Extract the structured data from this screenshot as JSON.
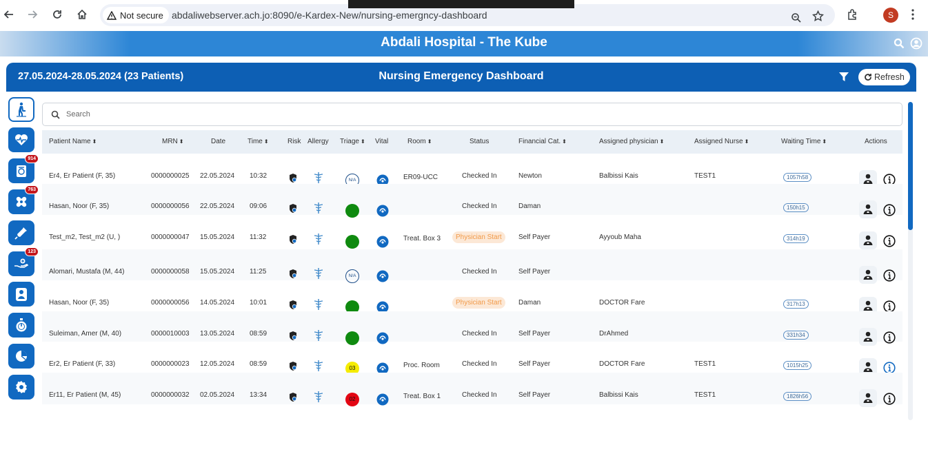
{
  "browser": {
    "security_label": "Not secure",
    "url": "abdaliwebserver.ach.jo:8090/e-Kardex-New/nursing-emergncy-dashboard",
    "profile_initial": "S"
  },
  "banner": {
    "title": "Abdali Hospital - The Kube"
  },
  "dashboard": {
    "date_range": "27.05.2024-28.05.2024 (23 Patients)",
    "title": "Nursing Emergency Dashboard",
    "refresh_label": "Refresh"
  },
  "sidebar": {
    "items": [
      {
        "icon": "patient-walking-icon",
        "badge": ""
      },
      {
        "icon": "heart-monitor-icon",
        "badge": ""
      },
      {
        "icon": "lab-report-icon",
        "badge": "914"
      },
      {
        "icon": "bandage-icon",
        "badge": "763"
      },
      {
        "icon": "syringe-icon",
        "badge": ""
      },
      {
        "icon": "hand-care-icon",
        "badge": "123"
      },
      {
        "icon": "nurse-icon",
        "badge": ""
      },
      {
        "icon": "stopwatch-icon",
        "badge": ""
      },
      {
        "icon": "pie-chart-icon",
        "badge": ""
      },
      {
        "icon": "settings-icon",
        "badge": ""
      }
    ]
  },
  "search": {
    "placeholder": "Search"
  },
  "table": {
    "headers": {
      "patient_name": "Patient Name",
      "mrn": "MRN",
      "date": "Date",
      "time": "Time",
      "risk": "Risk",
      "allergy": "Allergy",
      "triage": "Triage",
      "vital": "Vital",
      "room": "Room",
      "status": "Status",
      "financial": "Financial Cat.",
      "physician": "Assigned physician",
      "nurse": "Assigned Nurse",
      "waiting": "Waiting Time",
      "actions": "Actions"
    },
    "rows": [
      {
        "name": "Er4, Er Patient (F, 35)",
        "mrn": "0000000025",
        "date": "22.05.2024",
        "time": "10:32",
        "triage": "N/A",
        "triage_color": "none",
        "room": "ER09-UCC",
        "status": "Checked In",
        "status_pill": false,
        "financial": "Newton",
        "physician": "Balbissi Kais",
        "nurse": "TEST1",
        "waiting": "1057h58"
      },
      {
        "name": "Hasan, Noor (F, 35)",
        "mrn": "0000000056",
        "date": "22.05.2024",
        "time": "09:06",
        "triage": "04",
        "triage_color": "#0f8a0f",
        "room": "",
        "status": "Checked In",
        "status_pill": false,
        "financial": "Daman",
        "physician": "",
        "nurse": "",
        "waiting": "150h15"
      },
      {
        "name": "Test_m2, Test_m2 (U, )",
        "mrn": "0000000047",
        "date": "15.05.2024",
        "time": "11:32",
        "triage": "04",
        "triage_color": "#0f8a0f",
        "room": "Treat. Box 3",
        "status": "Physician Start",
        "status_pill": true,
        "financial": "Self Payer",
        "physician": "Ayyoub Maha",
        "nurse": "",
        "waiting": "314h19"
      },
      {
        "name": "Alomari, Mustafa (M, 44)",
        "mrn": "0000000058",
        "date": "15.05.2024",
        "time": "11:25",
        "triage": "N/A",
        "triage_color": "none",
        "room": "",
        "status": "Checked In",
        "status_pill": false,
        "financial": "Self Payer",
        "physician": "",
        "nurse": "",
        "waiting": ""
      },
      {
        "name": "Hasan, Noor (F, 35)",
        "mrn": "0000000056",
        "date": "14.05.2024",
        "time": "10:01",
        "triage": "04",
        "triage_color": "#0f8a0f",
        "room": "",
        "status": "Physician Start",
        "status_pill": true,
        "financial": "Daman",
        "physician": "DOCTOR Fare",
        "nurse": "",
        "waiting": "317h13"
      },
      {
        "name": "Suleiman, Amer (M, 40)",
        "mrn": "0000010003",
        "date": "13.05.2024",
        "time": "08:59",
        "triage": "04",
        "triage_color": "#0f8a0f",
        "room": "",
        "status": "Checked In",
        "status_pill": false,
        "financial": "Self Payer",
        "physician": "DrAhmed",
        "nurse": "",
        "waiting": "331h34"
      },
      {
        "name": "Er2, Er Patient (F, 33)",
        "mrn": "0000000023",
        "date": "12.05.2024",
        "time": "08:59",
        "triage": "03",
        "triage_color": "#f5ec00",
        "room": "Proc. Room",
        "status": "Checked In",
        "status_pill": false,
        "financial": "Self Payer",
        "physician": "DOCTOR Fare",
        "nurse": "TEST1",
        "waiting": "1015h25"
      },
      {
        "name": "Er11, Er Patient (M, 45)",
        "mrn": "0000000032",
        "date": "02.05.2024",
        "time": "13:34",
        "triage": "02",
        "triage_color": "#e30613",
        "room": "Treat. Box 1",
        "status": "Checked In",
        "status_pill": false,
        "financial": "Self Payer",
        "physician": "Balbissi Kais",
        "nurse": "TEST1",
        "waiting": "1826h56"
      }
    ]
  },
  "colors": {
    "primary": "#0d5fb4",
    "banner": "#2d86d6",
    "badge": "#c4161c",
    "triage_green": "#0f8a0f",
    "triage_yellow": "#f5ec00",
    "triage_red": "#e30613"
  }
}
